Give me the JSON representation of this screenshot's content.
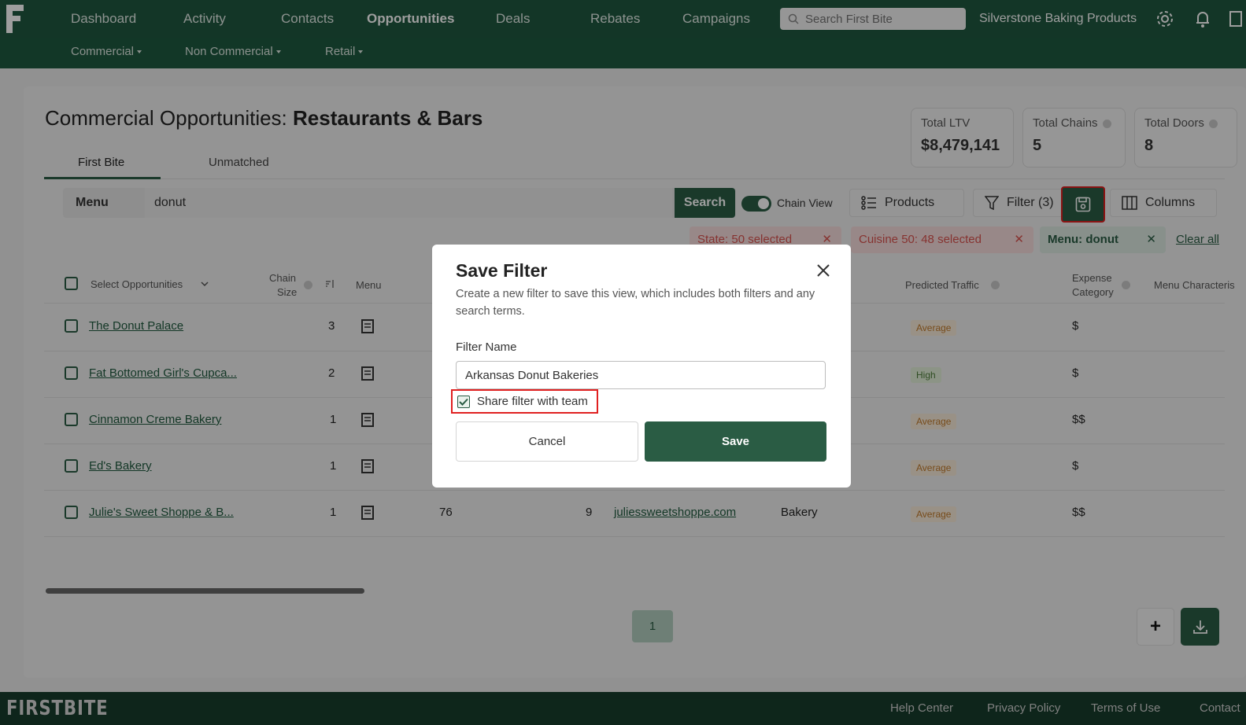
{
  "nav": {
    "items": [
      "Dashboard",
      "Activity",
      "Contacts",
      "Opportunities",
      "Deals",
      "Rebates",
      "Campaigns"
    ],
    "active": "Opportunities",
    "search_placeholder": "Search First Bite",
    "company": "Silverstone Baking Products"
  },
  "subnav": {
    "items": [
      "Commercial",
      "Non Commercial",
      "Retail"
    ]
  },
  "page": {
    "title_prefix": "Commercial Opportunities: ",
    "title_bold": "Restaurants & Bars",
    "tabs": [
      "First Bite",
      "Unmatched"
    ],
    "active_tab": "First Bite"
  },
  "stats": [
    {
      "label": "Total LTV",
      "value": "$8,479,141"
    },
    {
      "label": "Total Chains",
      "value": "5"
    },
    {
      "label": "Total Doors",
      "value": "8"
    }
  ],
  "toolbar": {
    "menu_label": "Menu",
    "query": "donut",
    "search_label": "Search",
    "chain_view_label": "Chain View",
    "products_label": "Products",
    "filter_label": "Filter (3)",
    "columns_label": "Columns"
  },
  "chips": [
    {
      "label": "State: 50 selected"
    },
    {
      "label": "Cuisine 50: 48 selected"
    },
    {
      "label": "Menu: donut"
    }
  ],
  "clear_all": "Clear all",
  "table": {
    "headers": {
      "select": "Select Opportunities",
      "chain_size_1": "Chain",
      "chain_size_2": "Size",
      "menu": "Menu",
      "predicted_traffic": "Predicted Traffic",
      "expense_1": "Expense",
      "expense_2": "Category",
      "menu_char": "Menu Characteris"
    },
    "rows": [
      {
        "name": "The Donut Palace",
        "chain_size": "3",
        "traffic": "Average",
        "expense": "$"
      },
      {
        "name": "Fat Bottomed Girl's Cupca...",
        "chain_size": "2",
        "traffic": "High",
        "expense": "$"
      },
      {
        "name": "Cinnamon Creme Bakery",
        "chain_size": "1",
        "traffic": "Average",
        "expense": "$$"
      },
      {
        "name": "Ed's Bakery",
        "chain_size": "1",
        "traffic": "Average",
        "expense": "$"
      },
      {
        "name": "Julie's Sweet Shoppe & B...",
        "chain_size": "1",
        "traffic": "Average",
        "expense": "$$",
        "col_a": "76",
        "col_b": "9",
        "website": "juliessweetshoppe.com",
        "cuisine": "Bakery"
      }
    ]
  },
  "pagination": {
    "current": "1"
  },
  "fab": {
    "plus": "+"
  },
  "modal": {
    "title": "Save Filter",
    "description": "Create a new filter to save this view, which includes both filters and any search terms.",
    "field_label": "Filter Name",
    "field_value": "Arkansas Donut Bakeries",
    "share_label": "Share filter with team",
    "share_checked": true,
    "cancel_label": "Cancel",
    "save_label": "Save"
  },
  "footer": {
    "logo": "FIRSTBITE",
    "links": [
      "Help Center",
      "Privacy Policy",
      "Terms of Use",
      "Contact"
    ]
  },
  "colors": {
    "brand": "#2a5c44",
    "highlight": "#e02020"
  }
}
